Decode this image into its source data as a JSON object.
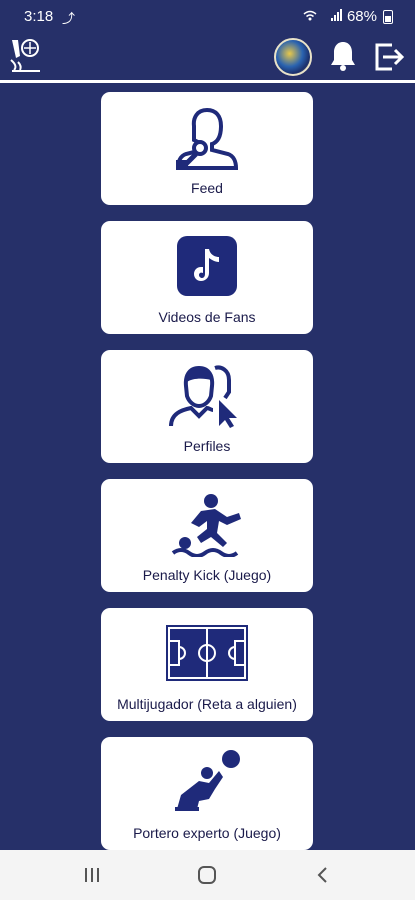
{
  "status": {
    "time": "3:18",
    "left_icon": "missed-call-icon",
    "right_icons": "wifi signal",
    "battery": "68%"
  },
  "header": {
    "logo": "club-logo",
    "avatar": "profile-avatar",
    "bell": "bell-icon",
    "logout": "logout-icon"
  },
  "menu": [
    {
      "label": "Feed",
      "icon": "microphone-speaker-icon"
    },
    {
      "label": "Videos de Fans",
      "icon": "tiktok-icon"
    },
    {
      "label": "Perfiles",
      "icon": "profiles-cursor-icon"
    },
    {
      "label": "Penalty Kick (Juego)",
      "icon": "soccer-kick-icon"
    },
    {
      "label": "Multijugador (Reta a alguien)",
      "icon": "soccer-field-icon"
    },
    {
      "label": "Portero experto (Juego)",
      "icon": "goalkeeper-icon"
    }
  ],
  "colors": {
    "background": "#263069",
    "card": "#ffffff",
    "icon": "#1f2a7a"
  }
}
